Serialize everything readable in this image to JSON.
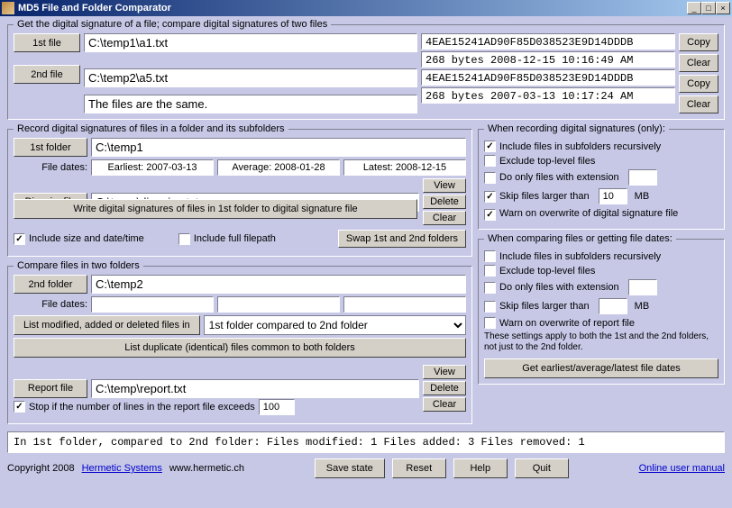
{
  "window_title": "MD5 File and Folder Comparator",
  "section1": {
    "legend": "Get the digital signature of a file; compare digital signatures of two files",
    "file1_btn": "1st file",
    "file1_path": "C:\\temp1\\a1.txt",
    "file2_btn": "2nd file",
    "file2_path": "C:\\temp2\\a5.txt",
    "hash1": "4EAE15241AD90F85D038523E9D14DDDB",
    "info1": "268 bytes  2008-12-15 10:16:49 AM",
    "hash2": "4EAE15241AD90F85D038523E9D14DDDB",
    "info2": "268 bytes  2007-03-13 10:17:24 AM",
    "copy": "Copy",
    "clear": "Clear",
    "result": "The files are the same."
  },
  "section2": {
    "legend": "Record digital signatures of files in a folder and its subfolders",
    "folder1_btn": "1st folder",
    "folder1_path": "C:\\temp1",
    "file_dates_label": "File dates:",
    "earliest": "Earliest: 2007-03-13",
    "average": "Average: 2008-01-28",
    "latest": "Latest: 2008-12-15",
    "digsig_btn": "Dig. sig. file",
    "digsig_path": "C:\\temp\\dig_sigs.txt",
    "view": "View",
    "delete": "Delete",
    "clear": "Clear",
    "write_btn": "Write digital signatures of files in 1st folder to digital signature file",
    "chk_size": "Include size and date/time",
    "chk_fullpath": "Include full filepath",
    "swap_btn": "Swap 1st and 2nd folders"
  },
  "section3": {
    "legend": "When recording digital signatures (only):",
    "chk_recursive": "Include files in subfolders recursively",
    "chk_exclude_top": "Exclude top-level files",
    "chk_only_ext": "Do only files with extension",
    "chk_skip_larger": "Skip files larger than",
    "skip_value": "10",
    "mb": "MB",
    "chk_warn": "Warn on overwrite of digital signature file"
  },
  "section4": {
    "legend": "Compare files in two folders",
    "folder2_btn": "2nd folder",
    "folder2_path": "C:\\temp2",
    "file_dates_label": "File dates:",
    "list_mod_btn": "List modified, added or deleted files in",
    "combo": "1st folder compared to 2nd folder",
    "list_dup_btn": "List duplicate (identical) files common to both folders",
    "report_btn": "Report file",
    "report_path": "C:\\temp\\report.txt",
    "view": "View",
    "delete": "Delete",
    "clear": "Clear",
    "chk_stop": "Stop if the number of lines in the report file exceeds",
    "stop_value": "100"
  },
  "section5": {
    "legend": "When comparing files or getting file dates:",
    "chk_recursive": "Include files in subfolders recursively",
    "chk_exclude_top": "Exclude top-level files",
    "chk_only_ext": "Do only files with extension",
    "chk_skip_larger": "Skip files larger than",
    "mb": "MB",
    "chk_warn": "Warn on overwrite of report file",
    "note": "These settings apply to both the 1st and the 2nd folders, not just to the 2nd folder.",
    "get_dates_btn": "Get earliest/average/latest file dates"
  },
  "status": "In 1st folder, compared to 2nd folder:   Files modified: 1   Files added: 3   Files removed: 1",
  "footer": {
    "copyright": "Copyright 2008",
    "link": "Hermetic Systems",
    "url": "www.hermetic.ch",
    "save": "Save state",
    "reset": "Reset",
    "help": "Help",
    "quit": "Quit",
    "manual": "Online user manual"
  }
}
